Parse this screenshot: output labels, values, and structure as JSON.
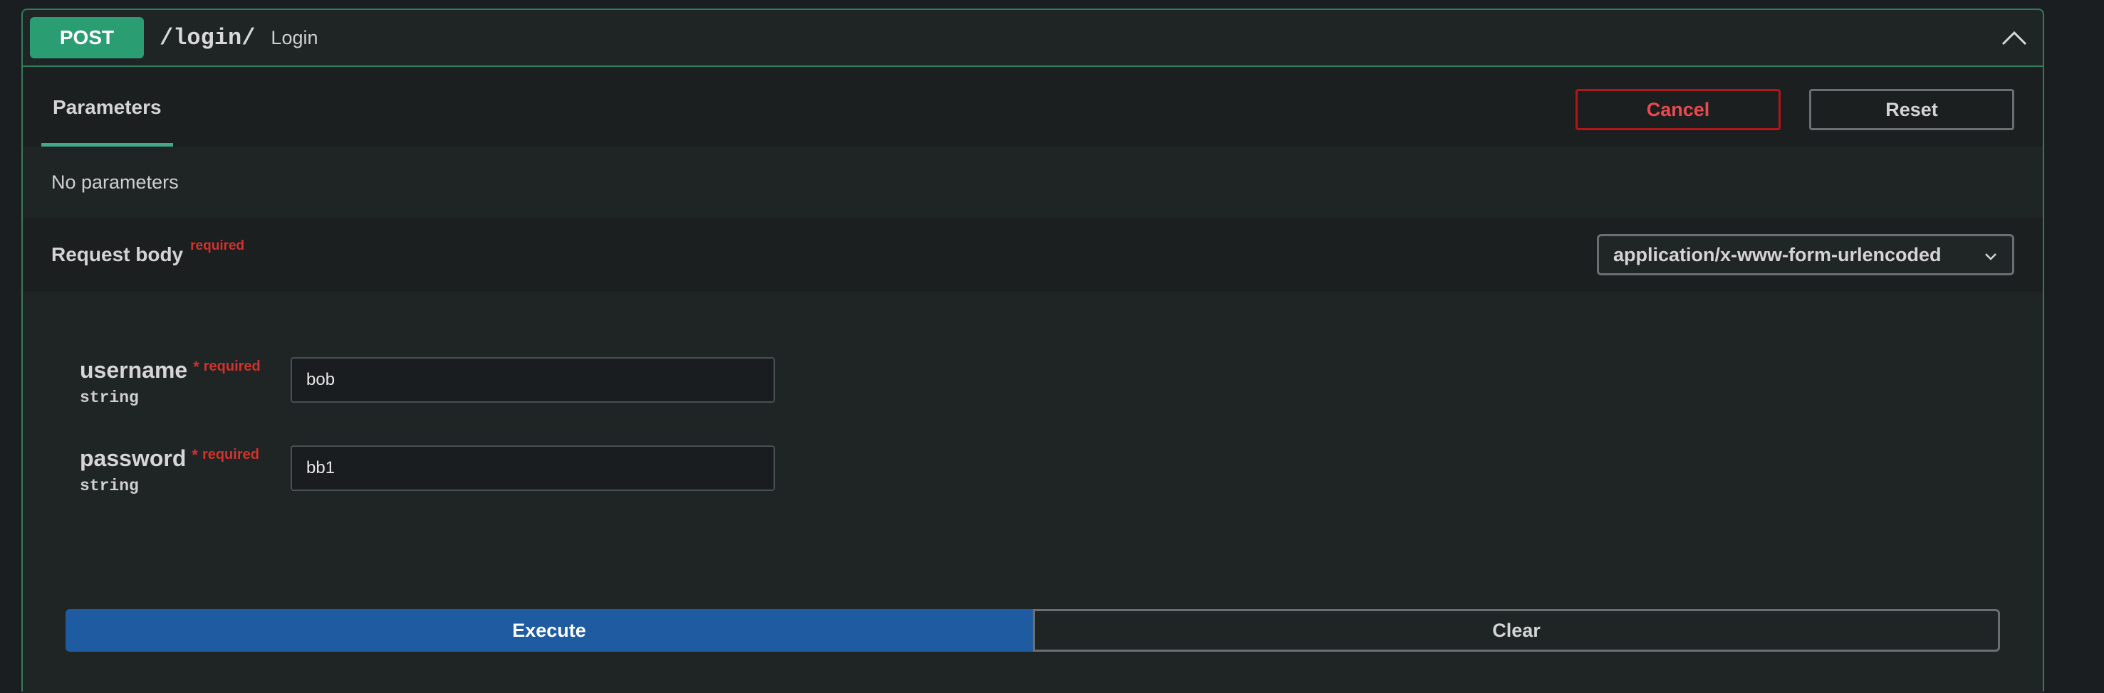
{
  "operation": {
    "method": "POST",
    "path": "/login/",
    "description": "Login",
    "collapse_icon": "chevron-up-icon"
  },
  "parameters": {
    "tab_label": "Parameters",
    "cancel_label": "Cancel",
    "reset_label": "Reset",
    "empty_text": "No parameters"
  },
  "request_body": {
    "label": "Request body",
    "required_label": "required",
    "content_type": "application/x-www-form-urlencoded",
    "dropdown_icon": "chevron-down-icon",
    "fields": [
      {
        "name": "username",
        "star": "*",
        "required": "required",
        "type": "string",
        "value": "bob"
      },
      {
        "name": "password",
        "star": "*",
        "required": "required",
        "type": "string",
        "value": "bb1"
      }
    ]
  },
  "actions": {
    "execute_label": "Execute",
    "clear_label": "Clear"
  },
  "colors": {
    "post_method": "#2b9d72",
    "border_accent": "#2f7d5a",
    "cancel": "#b1161c",
    "execute": "#1f5ba0",
    "required": "#d2322d"
  }
}
